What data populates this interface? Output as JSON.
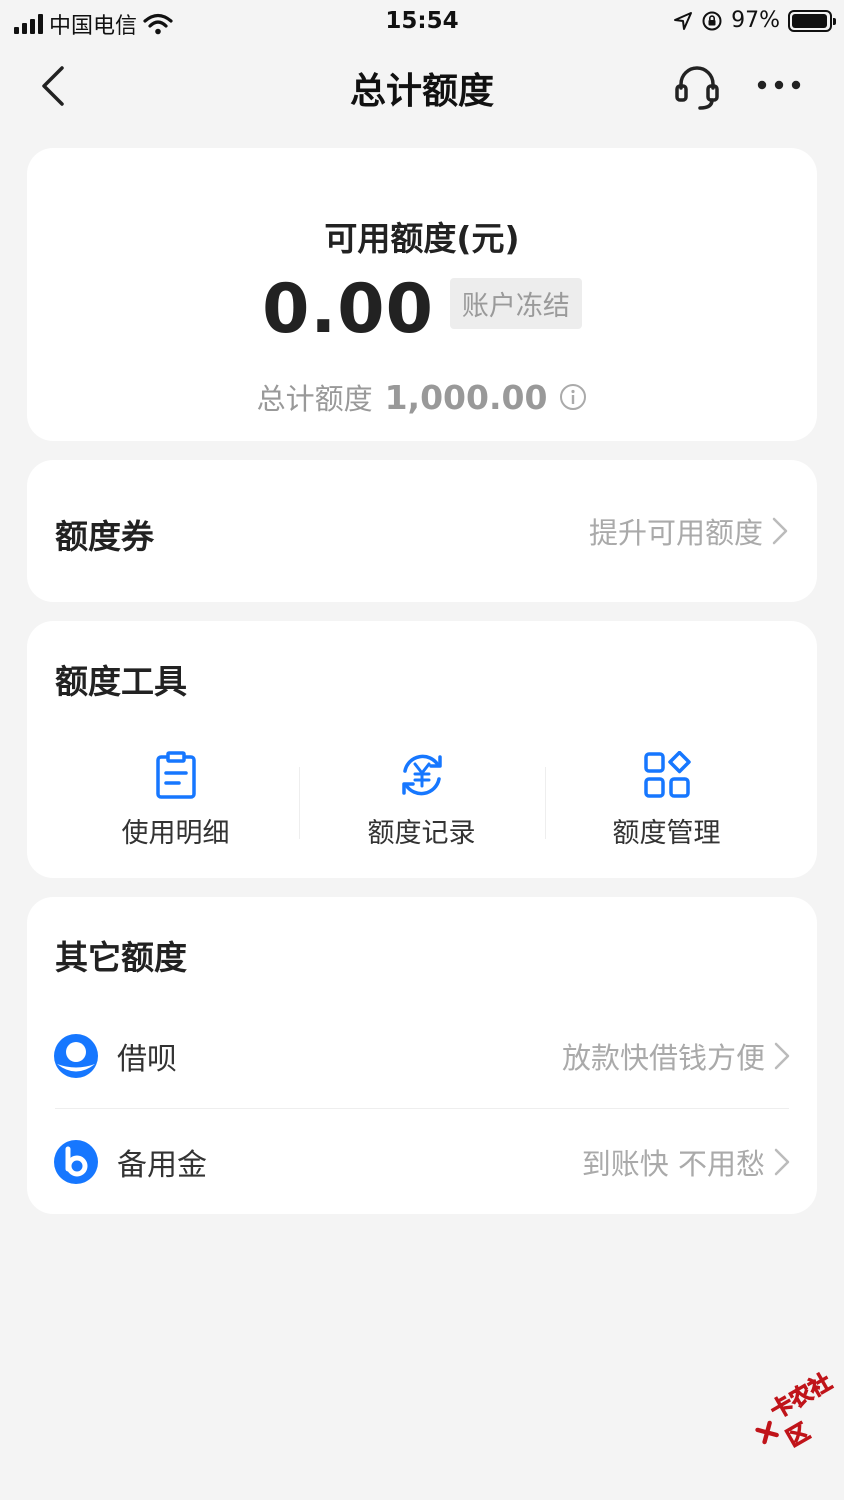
{
  "status_bar": {
    "carrier": "中国电信",
    "time": "15:54",
    "battery": "97%",
    "battery_level": 0.97
  },
  "nav": {
    "title": "总计额度",
    "icons": [
      "chevron-left-icon",
      "headset-icon",
      "more-icon"
    ]
  },
  "quota": {
    "label": "可用额度(元)",
    "available": "0.00",
    "status_badge": "账户冻结",
    "total_label": "总计额度",
    "total_value": "1,000.00"
  },
  "coupon": {
    "title": "额度券",
    "action": "提升可用额度"
  },
  "tools": {
    "title": "额度工具",
    "items": [
      {
        "label": "使用明细",
        "icon": "document-list-icon"
      },
      {
        "label": "额度记录",
        "icon": "yuan-refresh-icon"
      },
      {
        "label": "额度管理",
        "icon": "grid-diamond-icon"
      }
    ]
  },
  "other": {
    "title": "其它额度",
    "items": [
      {
        "name": "借呗",
        "slogan": "放款快借钱方便",
        "icon": "jiebei-logo-icon"
      },
      {
        "name": "备用金",
        "slogan": "到账快 不用愁",
        "icon": "beiyongjin-logo-icon"
      }
    ]
  },
  "colors": {
    "accent": "#1677ff",
    "background": "#f4f4f4",
    "card": "#ffffff"
  },
  "watermark": "卡农社区"
}
